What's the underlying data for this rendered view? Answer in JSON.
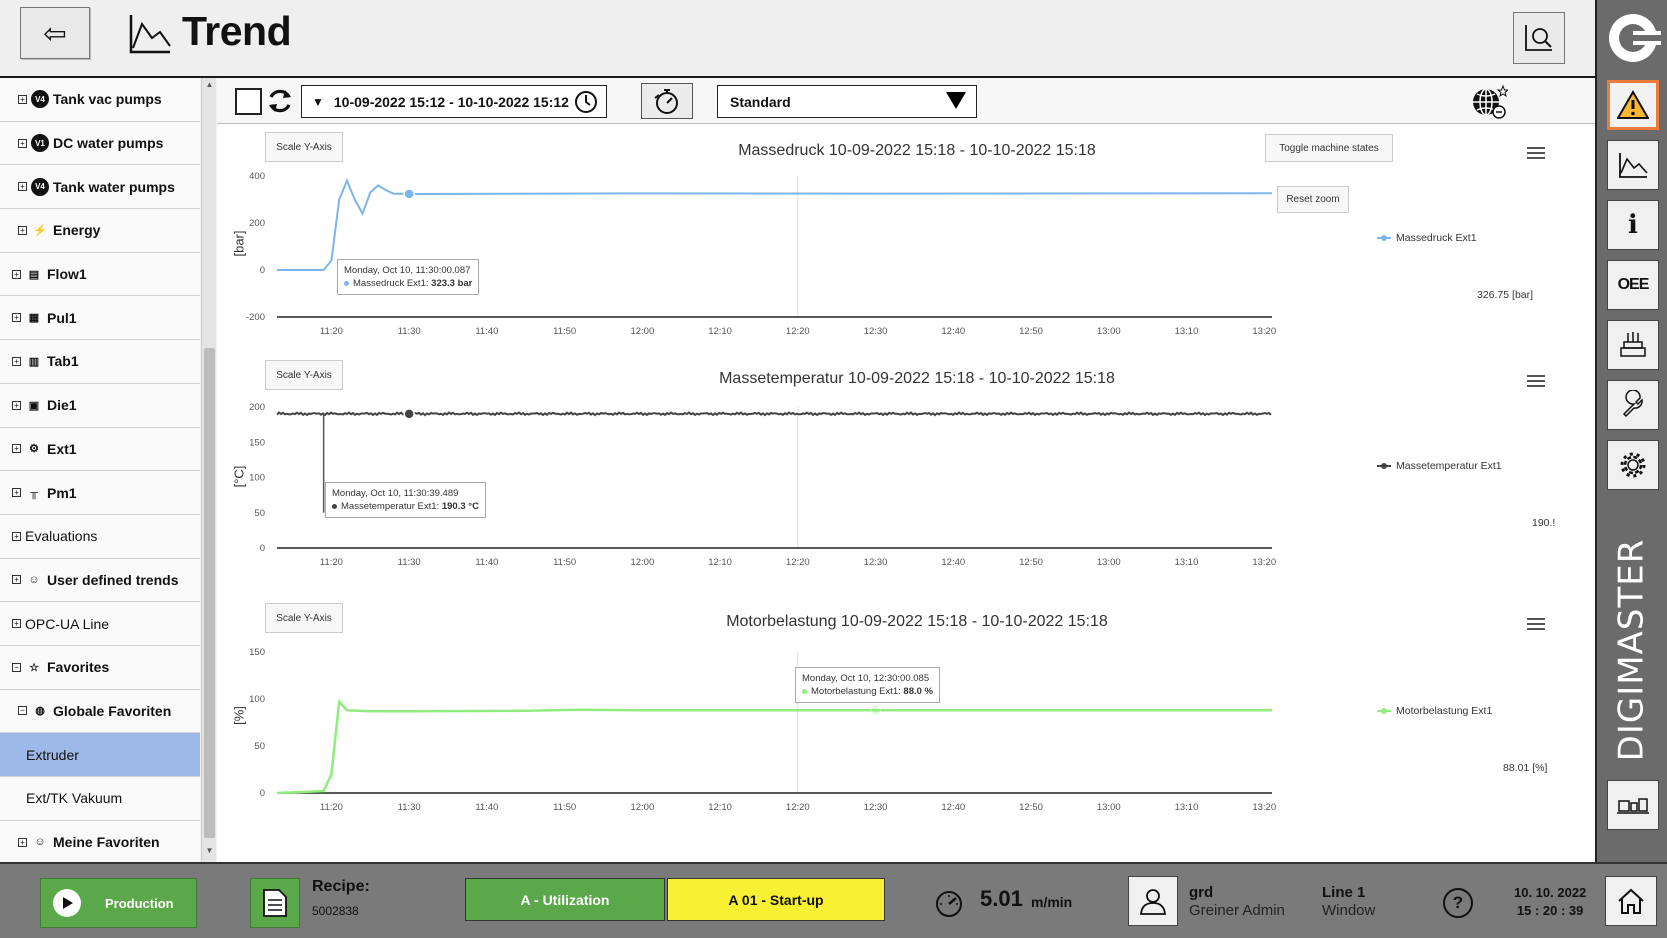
{
  "header": {
    "title": "Trend",
    "back_icon": "arrow-left-icon"
  },
  "tree": [
    {
      "label": "Tank vac pumps",
      "indent": 1,
      "badge": "V4",
      "expander": "+"
    },
    {
      "label": "DC water pumps",
      "indent": 1,
      "badge": "V1",
      "expander": "+"
    },
    {
      "label": "Tank water pumps",
      "indent": 1,
      "badge": "V4",
      "expander": "+"
    },
    {
      "label": "Energy",
      "indent": 1,
      "icon": "⚡",
      "expander": "+"
    },
    {
      "label": "Flow1",
      "indent": 0,
      "icon": "▤",
      "expander": "+"
    },
    {
      "label": "Pul1",
      "indent": 0,
      "icon": "▦",
      "expander": "+"
    },
    {
      "label": "Tab1",
      "indent": 0,
      "icon": "▥",
      "expander": "+"
    },
    {
      "label": "Die1",
      "indent": 0,
      "icon": "▣",
      "expander": "+"
    },
    {
      "label": "Ext1",
      "indent": 0,
      "icon": "⚙",
      "expander": "+"
    },
    {
      "label": "Pm1",
      "indent": 0,
      "icon": "╥",
      "expander": "+"
    },
    {
      "label": "Evaluations",
      "indent": 0,
      "expander": "+",
      "plain": true
    },
    {
      "label": "User defined trends",
      "indent": 0,
      "icon": "☺",
      "expander": "+"
    },
    {
      "label": "OPC-UA Line",
      "indent": 0,
      "expander": "+",
      "plain": true
    },
    {
      "label": "Favorites",
      "indent": 0,
      "icon": "☆",
      "expander": "−"
    },
    {
      "label": "Globale Favoriten",
      "indent": 1,
      "icon": "◍",
      "expander": "−"
    },
    {
      "label": "Extruder",
      "indent": 2,
      "selected": true,
      "plain": true
    },
    {
      "label": "Ext/TK Vakuum",
      "indent": 2,
      "plain": true
    },
    {
      "label": "Meine Favoriten",
      "indent": 1,
      "icon": "☺",
      "expander": "+"
    }
  ],
  "toolbar": {
    "daterange": "10-09-2022 15:12 - 10-10-2022 15:12",
    "preset": "Standard"
  },
  "charts": [
    {
      "title": "Massedruck 10-09-2022 15:18 - 10-10-2022 15:18",
      "scale_label": "Scale Y-Axis",
      "ylabel": "[bar]",
      "legend": "Massedruck Ext1",
      "current": "326.75 [bar]",
      "color": "#7cb5ec",
      "toggle_label": "Toggle machine states",
      "reset_label": "Reset zoom",
      "tooltip_date": "Monday, Oct 10, 11:30:00.087",
      "tooltip_series": "Massedruck Ext1",
      "tooltip_value": "323.3 bar"
    },
    {
      "title": "Massetemperatur 10-09-2022 15:18 - 10-10-2022 15:18",
      "scale_label": "Scale Y-Axis",
      "ylabel": "[°C]",
      "legend": "Massetemperatur Ext1",
      "current": "190.!",
      "color": "#434348",
      "tooltip_date": "Monday, Oct 10, 11:30:39.489",
      "tooltip_series": "Massetemperatur Ext1",
      "tooltip_value": "190.3 °C"
    },
    {
      "title": "Motorbelastung 10-09-2022 15:18 - 10-10-2022 15:18",
      "scale_label": "Scale Y-Axis",
      "ylabel": "[%]",
      "legend": "Motorbelastung Ext1",
      "current": "88.01 [%]",
      "color": "#90ed7d",
      "tooltip_date": "Monday, Oct 10, 12:30:00.085",
      "tooltip_series": "Motorbelastung Ext1",
      "tooltip_value": "88.0 %"
    }
  ],
  "chart_data": [
    {
      "type": "line",
      "title": "Massedruck 10-09-2022 15:18 - 10-10-2022 15:18",
      "ylabel": "[bar]",
      "ylim": [
        -200,
        400
      ],
      "yticks": [
        -200,
        0,
        200,
        400
      ],
      "xticks": [
        "11:20",
        "11:30",
        "11:40",
        "11:50",
        "12:00",
        "12:10",
        "12:20",
        "12:30",
        "12:40",
        "12:50",
        "13:00",
        "13:10",
        "13:20"
      ],
      "series": [
        {
          "name": "Massedruck Ext1",
          "color": "#7cb5ec",
          "x": [
            "11:13",
            "11:19",
            "11:20",
            "11:21",
            "11:22",
            "11:23",
            "11:24",
            "11:25",
            "11:26",
            "11:27",
            "11:28",
            "11:30",
            "12:00",
            "12:30",
            "13:00",
            "13:21"
          ],
          "y": [
            0,
            0,
            40,
            300,
            380,
            300,
            240,
            330,
            360,
            340,
            325,
            323.3,
            326,
            325,
            326,
            326.75
          ]
        }
      ]
    },
    {
      "type": "line",
      "title": "Massetemperatur 10-09-2022 15:18 - 10-10-2022 15:18",
      "ylabel": "[°C]",
      "ylim": [
        0,
        200
      ],
      "yticks": [
        0,
        50,
        100,
        150,
        200
      ],
      "xticks": [
        "11:20",
        "11:30",
        "11:40",
        "11:50",
        "12:00",
        "12:10",
        "12:20",
        "12:30",
        "12:40",
        "12:50",
        "13:00",
        "13:10",
        "13:20"
      ],
      "series": [
        {
          "name": "Massetemperatur Ext1",
          "color": "#434348",
          "x": [
            "11:13",
            "11:30",
            "12:00",
            "12:30",
            "13:00",
            "13:21"
          ],
          "y": [
            190.4,
            190.3,
            190.5,
            190.4,
            190.5,
            190.5
          ]
        }
      ]
    },
    {
      "type": "line",
      "title": "Motorbelastung 10-09-2022 15:18 - 10-10-2022 15:18",
      "ylabel": "[%]",
      "ylim": [
        0,
        150
      ],
      "yticks": [
        0,
        50,
        100,
        150
      ],
      "xticks": [
        "11:20",
        "11:30",
        "11:40",
        "11:50",
        "12:00",
        "12:10",
        "12:20",
        "12:30",
        "12:40",
        "12:50",
        "13:00",
        "13:10",
        "13:20"
      ],
      "series": [
        {
          "name": "Motorbelastung Ext1",
          "color": "#90ed7d",
          "x": [
            "11:13",
            "11:19",
            "11:20",
            "11:21",
            "11:22",
            "11:25",
            "11:30",
            "11:45",
            "11:52",
            "12:00",
            "12:30",
            "13:00",
            "13:21"
          ],
          "y": [
            0,
            2,
            20,
            97,
            88,
            87,
            87,
            87.5,
            88.5,
            88,
            88,
            88,
            88.01
          ]
        }
      ]
    }
  ],
  "footer": {
    "production": "Production",
    "recipe_label": "Recipe:",
    "recipe_value": "5002838",
    "utilization": "A - Utilization",
    "startup": "A 01 - Start-up",
    "speed": "5.01",
    "speed_unit": "m/min",
    "user_name": "grd",
    "user_role": "Greiner Admin",
    "line_name": "Line 1",
    "line_window": "Window",
    "date": "10. 10. 2022",
    "time": "15 : 20 : 39"
  },
  "rightbar": {
    "brand": "DIGIMASTER",
    "oee": "OEE"
  }
}
